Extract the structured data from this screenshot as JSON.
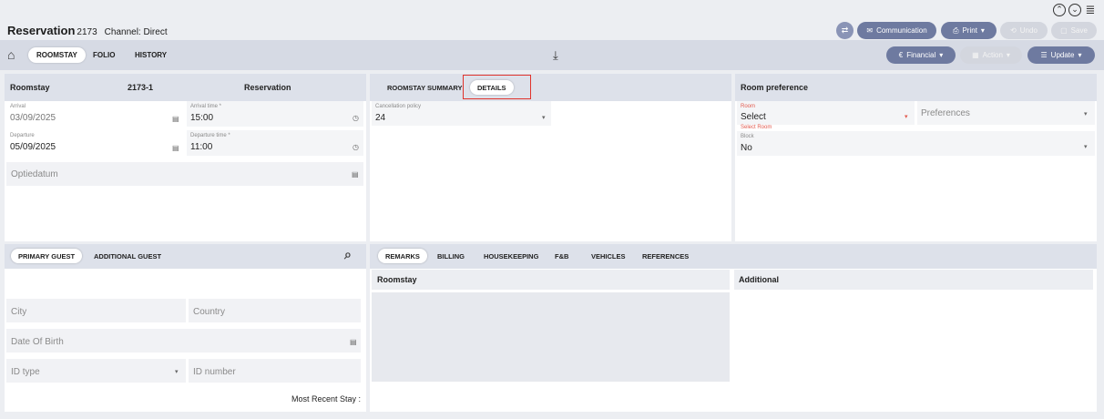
{
  "header": {
    "title": "Reservation",
    "res_no": "2173",
    "channel": "Channel: Direct"
  },
  "top_icons": [
    "chevron-up-circle-icon",
    "chevron-down-circle-icon",
    "list-icon"
  ],
  "actions": {
    "communication": "Communication",
    "print": "Print",
    "undo": "Undo",
    "save": "Save"
  },
  "nav": {
    "tabs": [
      "ROOMSTAY",
      "FOLIO",
      "HISTORY"
    ],
    "active": "ROOMSTAY",
    "financial": "Financial",
    "action": "Action",
    "update": "Update"
  },
  "roomstay": {
    "head_label": "Roomstay",
    "head_id": "2173-1",
    "head_type": "Reservation",
    "arrival_label": "Arrival",
    "arrival": "03/09/2025",
    "arrival_time_label": "Arrival time *",
    "arrival_time": "15:00",
    "departure_label": "Departure",
    "departure": "05/09/2025",
    "departure_time_label": "Departure time *",
    "departure_time": "11:00",
    "optiedatum": "Optiedatum"
  },
  "details": {
    "tabs": [
      "ROOMSTAY SUMMARY",
      "DETAILS"
    ],
    "active": "DETAILS",
    "cancel_label": "Cancellation policy",
    "cancel_value": "24"
  },
  "room_pref": {
    "title": "Room preference",
    "room_label": "Room",
    "room_value": "Select",
    "room_error": "Select Room",
    "preferences": "Preferences",
    "block_label": "Block",
    "block_value": "No"
  },
  "guest": {
    "tabs": [
      "PRIMARY GUEST",
      "ADDITIONAL GUEST"
    ],
    "active": "PRIMARY GUEST",
    "city": "City",
    "country": "Country",
    "dob": "Date Of Birth",
    "id_type": "ID type",
    "id_number": "ID number",
    "recent": "Most Recent Stay :"
  },
  "remarks": {
    "tabs": [
      "REMARKS",
      "BILLING",
      "HOUSEKEEPING",
      "F&B",
      "VEHICLES",
      "REFERENCES"
    ],
    "active": "REMARKS",
    "roomstay": "Roomstay",
    "additional": "Additional"
  },
  "colors": {
    "accent": "#6e7aa0",
    "highlight": "#e0332c",
    "error": "#e25b4f"
  }
}
